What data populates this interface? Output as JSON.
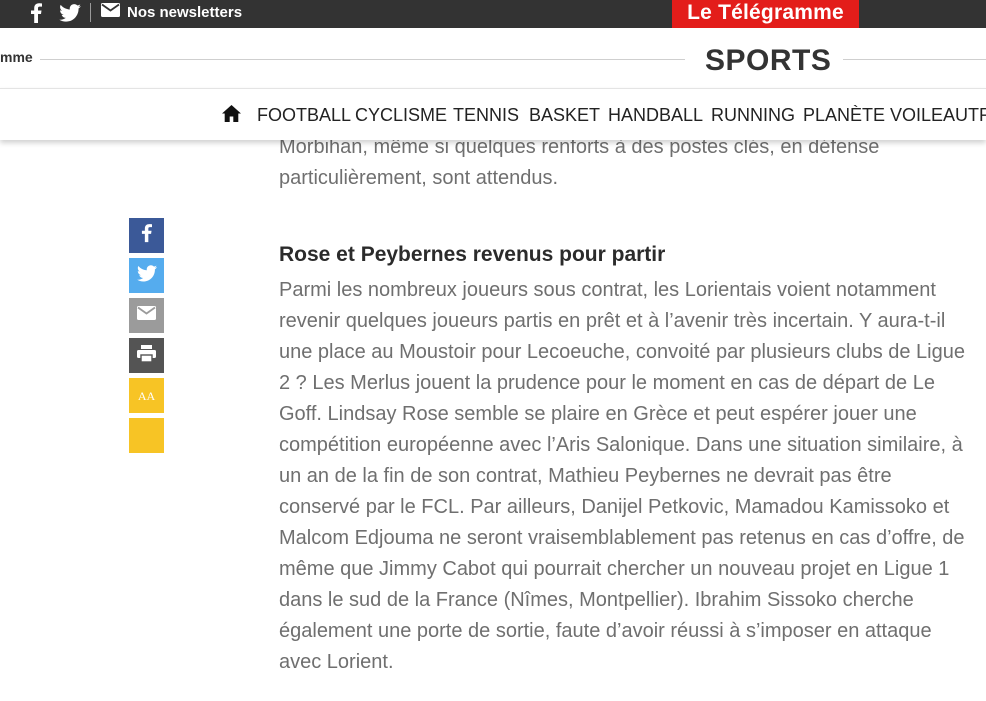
{
  "topbar": {
    "newsletter_label": "Nos newsletters",
    "logo_text": "Le Télégramme",
    "logo_color": "#e31d1a",
    "icons": [
      "facebook-icon",
      "twitter-icon",
      "mail-icon"
    ]
  },
  "section": {
    "brand_tail": "mme",
    "title": "SPORTS"
  },
  "nav": {
    "home_icon": "home-icon",
    "items": [
      "FOOTBALL",
      "CYCLISME",
      "TENNIS",
      "BASKET",
      "HANDBALL",
      "RUNNING",
      "PLANÈTE VOILE",
      "AUTR"
    ]
  },
  "share": {
    "icons": [
      "facebook-icon",
      "twitter-icon",
      "mail-icon",
      "print-icon",
      "font-size-icon",
      "night-mode-icon"
    ],
    "font_size_label": "AA",
    "colors": {
      "facebook": "#3b5998",
      "twitter": "#55acee",
      "mail": "#9b9b9b",
      "print": "#545454",
      "font": "#f7c425",
      "moon": "#f7c425"
    }
  },
  "article": {
    "intro_paragraph": "Morbihan, même si quelques renforts à des postes clés, en défense particulièrement, sont attendus.",
    "heading": "Rose et Peybernes revenus pour partir",
    "paragraph": "Parmi les nombreux joueurs sous contrat, les Lorientais voient notamment revenir quelques joueurs partis en prêt et à l’avenir très incertain. Y aura-t-il une place au Moustoir pour Lecoeuche, convoité par plusieurs clubs de Ligue 2 ? Les Merlus jouent la prudence pour le moment en cas de départ de Le Goff. Lindsay Rose semble se plaire en Grèce et peut espérer jouer une compétition européenne avec l’Aris Salonique. Dans une situation similaire, à un an de la fin de son contrat, Mathieu Peybernes ne devrait pas être conservé par le FCL. Par ailleurs, Danijel Petkovic, Mamadou Kamissoko et Malcom Edjouma ne seront vraisemblablement pas retenus en cas d’offre, de même que Jimmy Cabot qui pourrait chercher un nouveau projet en Ligue 1 dans le sud de la France (Nîmes, Montpellier). Ibrahim Sissoko cherche également une porte de sortie, faute d’avoir réussi à s’imposer en attaque avec Lorient."
  }
}
